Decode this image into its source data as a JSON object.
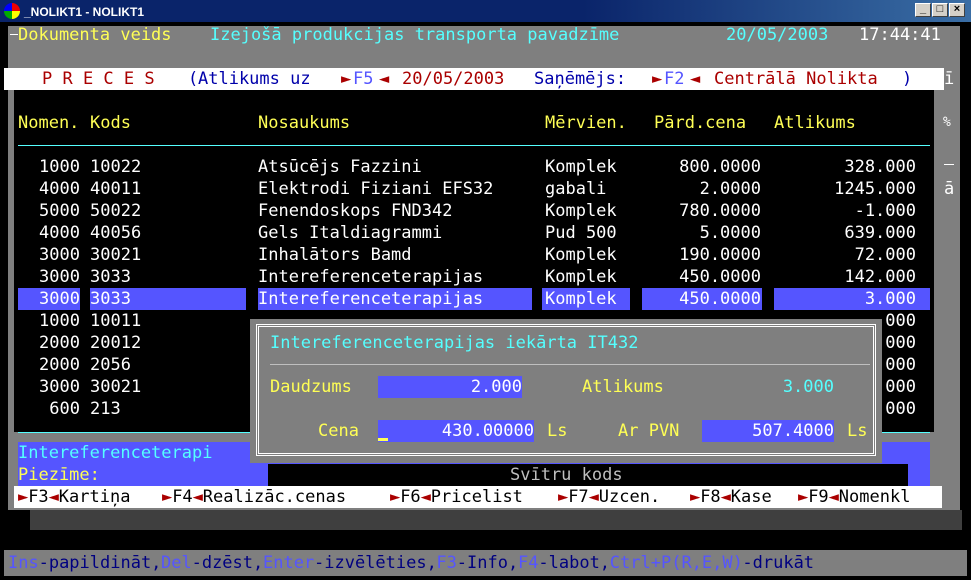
{
  "window": {
    "title": "_NOLIKT1 - NOLIKT1",
    "minimize_glyph": "_",
    "maximize_glyph": "□",
    "close_glyph": "×"
  },
  "header": {
    "label": "Dokumenta veids",
    "doc_type": "Izejošā produkcijas transporta pavadzīme",
    "date": "20/05/2003",
    "time": "17:44:41"
  },
  "preces_bar": {
    "title": "P R E C E S",
    "open_paren": "(",
    "atlikums_label": "Atlikums uz",
    "f5_key": "F5",
    "f5_date": "20/05/2003",
    "recipient_label": "Saņēmējs:",
    "f2_key": "F2",
    "recipient": "Centrālā Nolikta",
    "close_paren": ")"
  },
  "table": {
    "columns": [
      "Nomen.",
      "Kods",
      "Nosaukums",
      "Mērvien.",
      "Pārd.cena",
      "Atlikums"
    ],
    "rows": [
      {
        "nomen": "1000",
        "kods": "10022",
        "nosaukums": "Atsūcējs Fazzini",
        "merv": "Komplek",
        "cena": "800.0000",
        "atlikums": "328.000"
      },
      {
        "nomen": "4000",
        "kods": "40011",
        "nosaukums": "Elektrodi Fiziani EFS32",
        "merv": "gabali",
        "cena": "2.0000",
        "atlikums": "1245.000"
      },
      {
        "nomen": "5000",
        "kods": "50022",
        "nosaukums": "Fenendoskops FND342",
        "merv": "Komplek",
        "cena": "780.0000",
        "atlikums": "-1.000"
      },
      {
        "nomen": "4000",
        "kods": "40056",
        "nosaukums": "Gels Italdiagrammi",
        "merv": "Pud 500",
        "cena": "5.0000",
        "atlikums": "639.000"
      },
      {
        "nomen": "3000",
        "kods": "30021",
        "nosaukums": "Inhalātors Bamd",
        "merv": "Komplek",
        "cena": "190.0000",
        "atlikums": "72.000"
      },
      {
        "nomen": "3000",
        "kods": "3033",
        "nosaukums": "Intereferenceterapijas",
        "merv": "Komplek",
        "cena": "450.0000",
        "atlikums": "142.000"
      },
      {
        "nomen": "3000",
        "kods": "3033",
        "nosaukums": "Intereferenceterapijas",
        "merv": "Komplek",
        "cena": "450.0000",
        "atlikums": "3.000"
      },
      {
        "nomen": "1000",
        "kods": "10011",
        "nosaukums": "",
        "merv": "",
        "cena": "",
        "atlikums": "000"
      },
      {
        "nomen": "2000",
        "kods": "20012",
        "nosaukums": "",
        "merv": "",
        "cena": "",
        "atlikums": "000"
      },
      {
        "nomen": "2000",
        "kods": "2056",
        "nosaukums": "",
        "merv": "",
        "cena": "",
        "atlikums": "000"
      },
      {
        "nomen": "3000",
        "kods": "30021",
        "nosaukums": "",
        "merv": "",
        "cena": "",
        "atlikums": "000"
      },
      {
        "nomen": "600",
        "kods": "213",
        "nosaukums": "",
        "merv": "",
        "cena": "",
        "atlikums": "000"
      }
    ]
  },
  "right_marks": {
    "m1": "ī",
    "m2": "%",
    "m3": "ā"
  },
  "dialog": {
    "title": "Intereferenceterapijas iekārta IT432",
    "daudzums_label": "Daudzums",
    "daudzums": "2.000",
    "atlikums_label": "Atlikums",
    "atlikums": "3.000",
    "cena_label": "Cena",
    "cena": "430.00000",
    "cena_unit": "Ls",
    "pvn_label": "Ar PVN",
    "pvn": "507.4000",
    "pvn_unit": "Ls"
  },
  "detail": {
    "name": "Intereferenceterapi",
    "piezime_label": "Piezīme:",
    "barcode_label": "Svītru kods"
  },
  "fkeys": [
    {
      "key": "F3",
      "label": "Kartiņa"
    },
    {
      "key": "F4",
      "label": "Realizāc.cenas"
    },
    {
      "key": "F6",
      "label": "Pricelist"
    },
    {
      "key": "F7",
      "label": "Uzcen."
    },
    {
      "key": "F8",
      "label": "Kase"
    },
    {
      "key": "F9",
      "label": "Nomenkl"
    }
  ],
  "status_bar": [
    {
      "k": "Ins",
      "t": "-papildināt,"
    },
    {
      "k": "Del",
      "t": "-dzēst,"
    },
    {
      "k": "Enter",
      "t": "-izvēlēties,"
    },
    {
      "k": "F3",
      "t": "-Info,"
    },
    {
      "k": "F4",
      "t": "-labot,"
    },
    {
      "k": "Ctrl+P(R,E,W)",
      "t": "-drukāt"
    }
  ],
  "colors": {
    "accent": "#5555ff",
    "cyan": "#55ffff",
    "yellow": "#ffff55",
    "gray": "#7f7f7f",
    "red": "#aa0000"
  }
}
